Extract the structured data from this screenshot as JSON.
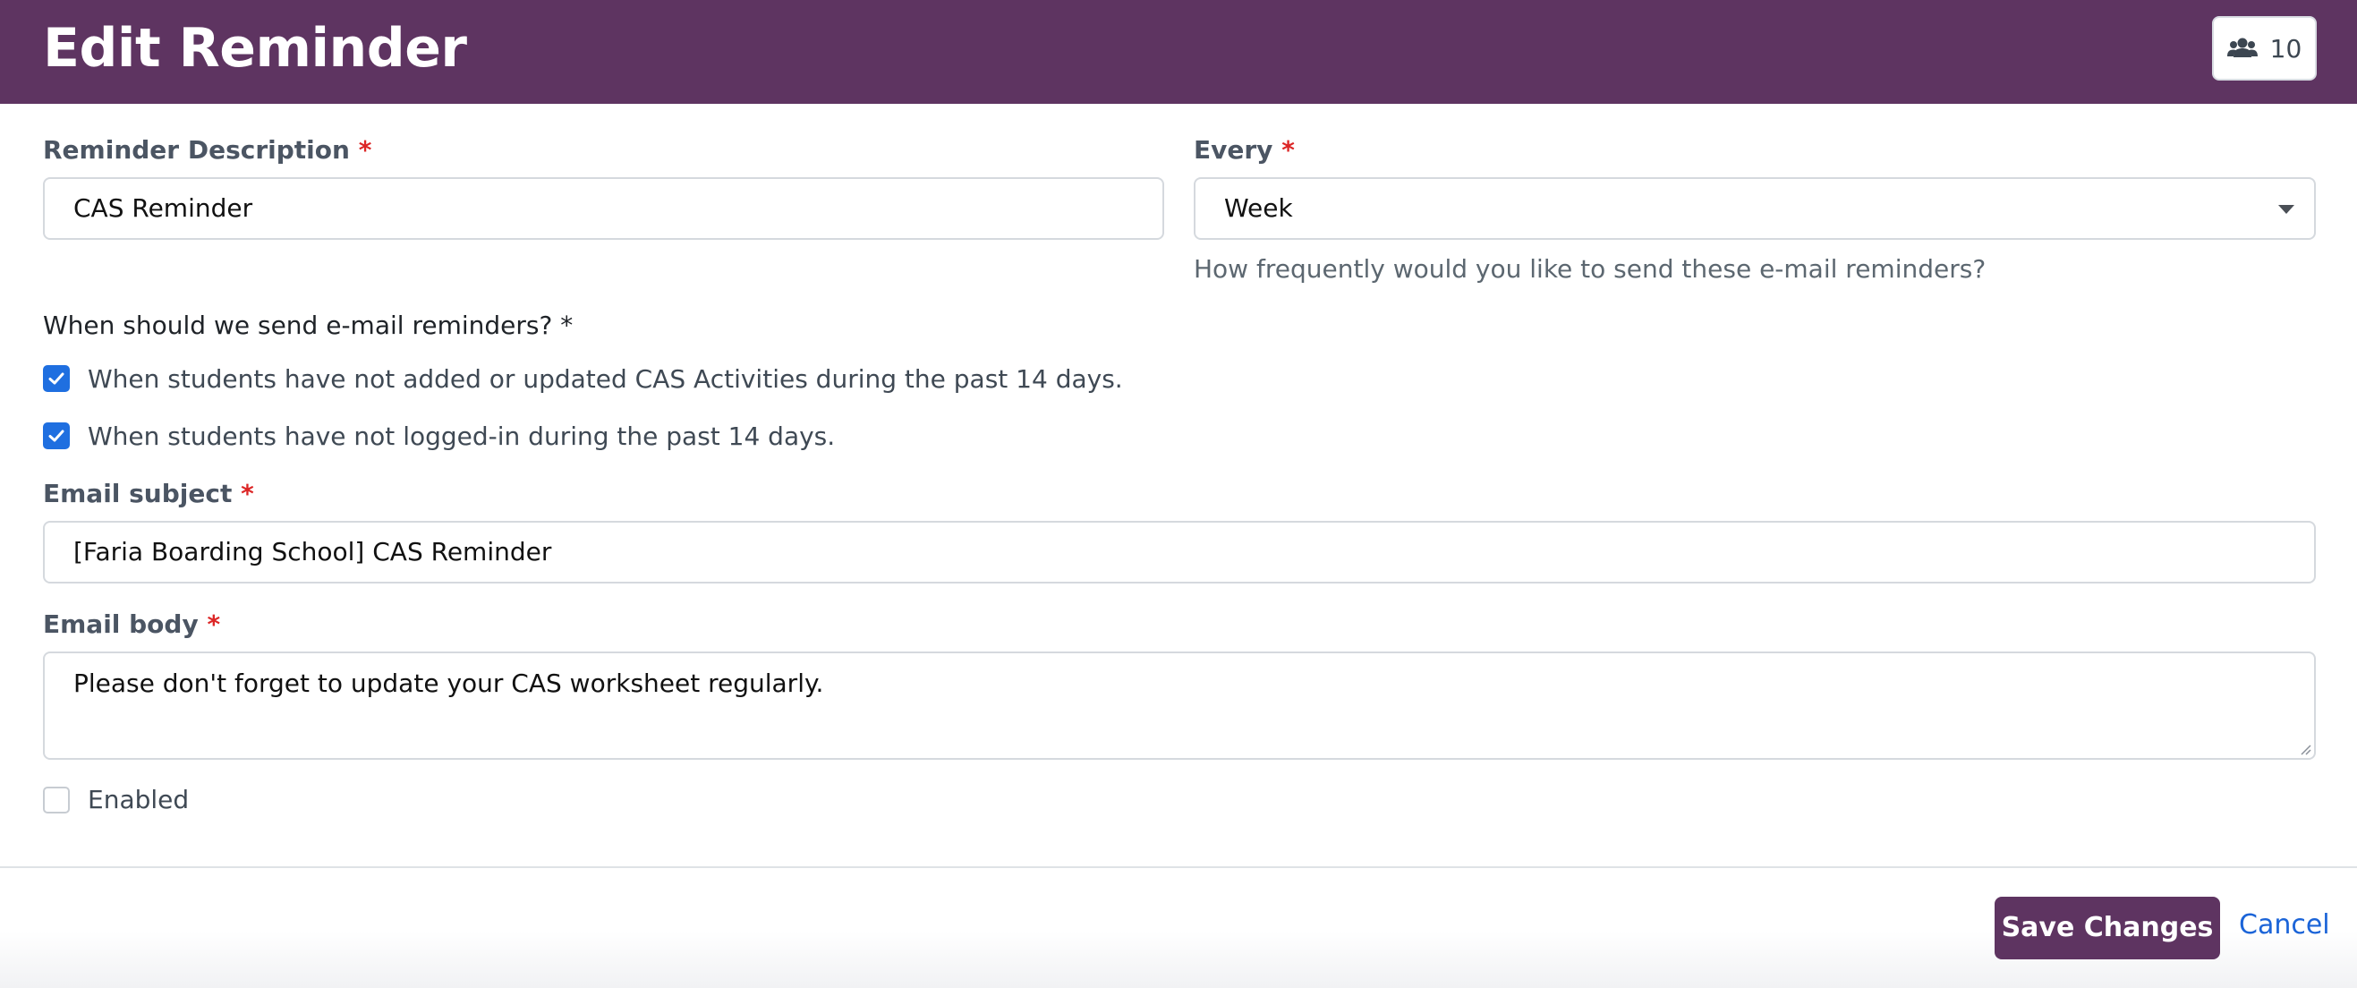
{
  "header": {
    "title": "Edit Reminder",
    "user_count": "10"
  },
  "form": {
    "description": {
      "label": "Reminder Description",
      "required_mark": "*",
      "value": "CAS Reminder"
    },
    "every": {
      "label": "Every",
      "required_mark": "*",
      "selected": "Week",
      "help": "How frequently would you like to send these e-mail reminders?"
    },
    "send_when": {
      "question": "When should we send e-mail reminders? *",
      "options": [
        {
          "label": "When students have not added or updated CAS Activities during the past 14 days.",
          "checked": true
        },
        {
          "label": "When students have not logged-in during the past 14 days.",
          "checked": true
        }
      ]
    },
    "email_subject": {
      "label": "Email subject",
      "required_mark": "*",
      "value": "[Faria Boarding School] CAS Reminder"
    },
    "email_body": {
      "label": "Email body",
      "required_mark": "*",
      "value": "Please don't forget to update your CAS worksheet regularly."
    },
    "enabled": {
      "label": "Enabled",
      "checked": false
    }
  },
  "footer": {
    "save_label": "Save Changes",
    "cancel_label": "Cancel"
  },
  "colors": {
    "brand": "#5e3461",
    "checkbox": "#1f6fe0",
    "link": "#1b64d8",
    "required": "#dc2626"
  },
  "icons": {
    "user_count": "users-icon",
    "checkbox": "check-icon",
    "select": "caret-down-icon"
  }
}
